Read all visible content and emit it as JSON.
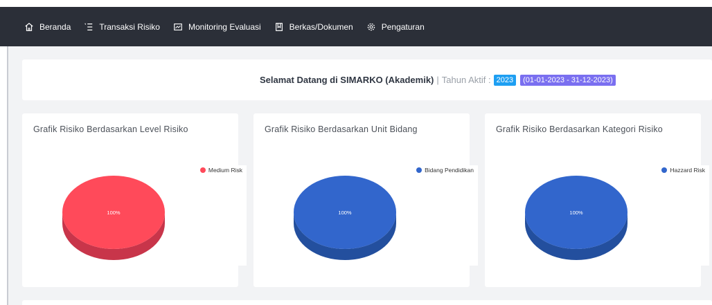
{
  "nav": {
    "items": [
      {
        "label": "Beranda",
        "icon": "home-icon"
      },
      {
        "label": "Transaksi Risiko",
        "icon": "list-icon"
      },
      {
        "label": "Monitoring Evaluasi",
        "icon": "monitor-icon"
      },
      {
        "label": "Berkas/Dokumen",
        "icon": "document-icon"
      },
      {
        "label": "Pengaturan",
        "icon": "gear-icon"
      }
    ]
  },
  "welcome": {
    "title": "Selamat Datang di SIMARKO (Akademik)",
    "separator": "|",
    "active_year_label": "Tahun Aktif :",
    "year": "2023",
    "range": "(01-01-2023 - 31-12-2023)"
  },
  "cards": [
    {
      "title": "Grafik Risiko Berdasarkan Level Risiko"
    },
    {
      "title": "Grafik Risiko Berdasarkan Unit Bidang"
    },
    {
      "title": "Grafik Risiko Berdasarkan Kategori Risiko"
    }
  ],
  "chart_data": [
    {
      "type": "pie",
      "title": "Grafik Risiko Berdasarkan Level Risiko",
      "categories": [
        "Medium Risk"
      ],
      "values": [
        100
      ],
      "labels": [
        "100%"
      ],
      "colors": [
        "#ff4a5a"
      ],
      "shadow": "#c8354a",
      "legend": "top-right"
    },
    {
      "type": "pie",
      "title": "Grafik Risiko Berdasarkan Unit Bidang",
      "categories": [
        "Bidang Pendidikan"
      ],
      "values": [
        100
      ],
      "labels": [
        "100%"
      ],
      "colors": [
        "#3266cc"
      ],
      "shadow": "#234f9e",
      "legend": "top-right"
    },
    {
      "type": "pie",
      "title": "Grafik Risiko Berdasarkan Kategori Risiko",
      "categories": [
        "Hazzard Risk"
      ],
      "values": [
        100
      ],
      "labels": [
        "100%"
      ],
      "colors": [
        "#3266cc"
      ],
      "shadow": "#234f9e",
      "legend": "top-right"
    }
  ]
}
